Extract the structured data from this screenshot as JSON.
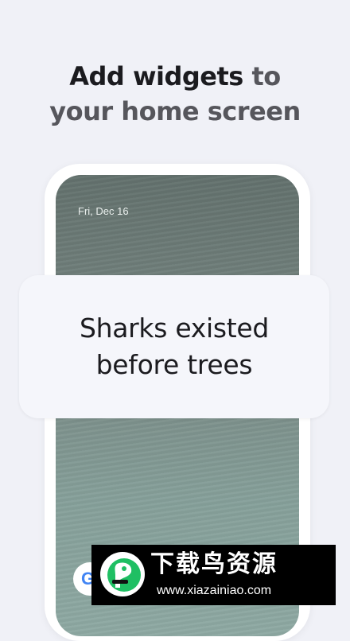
{
  "headline": {
    "line1_bold": "Add widgets",
    "line1_rest": " to",
    "line2": "your home screen"
  },
  "phone": {
    "date": "Fri, Dec 16",
    "google_letter": "G"
  },
  "fact_card": {
    "line1": "Sharks existed",
    "line2": "before trees"
  },
  "watermark": {
    "title": "下载鸟资源",
    "url": "www.xiazainiao.com"
  },
  "colors": {
    "background": "#f0f1f7",
    "headline_dark": "#1b1b1f",
    "headline_muted": "#56565c",
    "card": "#f5f6fb",
    "watermark_bg": "#000000",
    "watermark_logo_green": "#1fbf63"
  }
}
